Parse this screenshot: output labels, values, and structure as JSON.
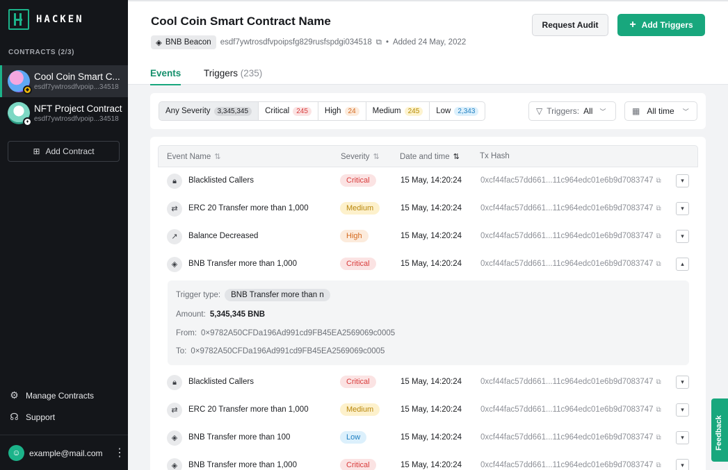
{
  "brand": {
    "name": "HACKEN",
    "accent": "#18a77d"
  },
  "sidebar": {
    "heading": "CONTRACTS (2/3)",
    "contracts": [
      {
        "name": "Cool Coin Smart C...",
        "address": "esdf7ywtrosdfvpoip...34518",
        "chain_icon": "bnb-icon",
        "active": true
      },
      {
        "name": "NFT Project Contract",
        "address": "esdf7ywtrosdfvpoip...34518",
        "chain_icon": "eth-icon",
        "active": false
      }
    ],
    "add_contract": "Add Contract",
    "manage": "Manage Contracts",
    "support": "Support",
    "user_email": "example@mail.com"
  },
  "header": {
    "title": "Cool Coin Smart Contract Name",
    "chain": "BNB Beacon",
    "address": "esdf7ywtrosdfvpoipsfg829rusfspdgi034518",
    "dot": "•",
    "added": "Added 24 May, 2022",
    "request_audit": "Request Audit",
    "add_triggers": "Add Triggers",
    "tabs": [
      {
        "label": "Events",
        "count": ""
      },
      {
        "label": "Triggers",
        "count": "(235)"
      }
    ]
  },
  "filters": {
    "severities": [
      {
        "label": "Any Severity",
        "count": "3,345,345"
      },
      {
        "label": "Critical",
        "count": "245"
      },
      {
        "label": "High",
        "count": "24"
      },
      {
        "label": "Medium",
        "count": "245"
      },
      {
        "label": "Low",
        "count": "2,343"
      }
    ],
    "triggers_label": "Triggers:",
    "triggers_value": "All",
    "time": "All time"
  },
  "table": {
    "columns": [
      "Event Name",
      "Severity",
      "Date and time",
      "Tx Hash"
    ],
    "rows": [
      {
        "icon": "lock-icon",
        "name": "Blacklisted Callers",
        "severity": "Critical",
        "date": "15 May, 14:20:24",
        "hash": "0xcf44fac57dd661...11c964edc01e6b9d7083747"
      },
      {
        "icon": "transfer-icon",
        "name": "ERC 20 Transfer more than 1,000",
        "severity": "Medium",
        "date": "15 May, 14:20:24",
        "hash": "0xcf44fac57dd661...11c964edc01e6b9d7083747"
      },
      {
        "icon": "trend-icon",
        "name": "Balance Decreased",
        "severity": "High",
        "date": "15 May, 14:20:24",
        "hash": "0xcf44fac57dd661...11c964edc01e6b9d7083747"
      },
      {
        "icon": "bnb-icon",
        "name": "BNB Transfer more than 1,000",
        "severity": "Critical",
        "date": "15 May, 14:20:24",
        "hash": "0xcf44fac57dd661...11c964edc01e6b9d7083747",
        "expanded": true
      },
      {
        "icon": "lock-icon",
        "name": "Blacklisted Callers",
        "severity": "Critical",
        "date": "15 May, 14:20:24",
        "hash": "0xcf44fac57dd661...11c964edc01e6b9d7083747"
      },
      {
        "icon": "transfer-icon",
        "name": "ERC 20 Transfer more than 1,000",
        "severity": "Medium",
        "date": "15 May, 14:20:24",
        "hash": "0xcf44fac57dd661...11c964edc01e6b9d7083747"
      },
      {
        "icon": "bnb-icon",
        "name": "BNB Transfer more than 100",
        "severity": "Low",
        "date": "15 May, 14:20:24",
        "hash": "0xcf44fac57dd661...11c964edc01e6b9d7083747"
      },
      {
        "icon": "bnb-icon",
        "name": "BNB Transfer more than 1,000",
        "severity": "Critical",
        "date": "15 May, 14:20:24",
        "hash": "0xcf44fac57dd661...11c964edc01e6b9d7083747"
      }
    ],
    "detail": {
      "trigger_type_label": "Trigger type:",
      "trigger_type": "BNB Transfer more than n",
      "amount_label": "Amount:",
      "amount": "5,345,345 BNB",
      "from_label": "From:",
      "from": "0×9782A50CFDa196Ad991cd9FB45EA2569069c0005",
      "to_label": "To:",
      "to": "0×9782A50CFDa196Ad991cd9FB45EA2569069c0005"
    }
  },
  "feedback": "Feedback"
}
